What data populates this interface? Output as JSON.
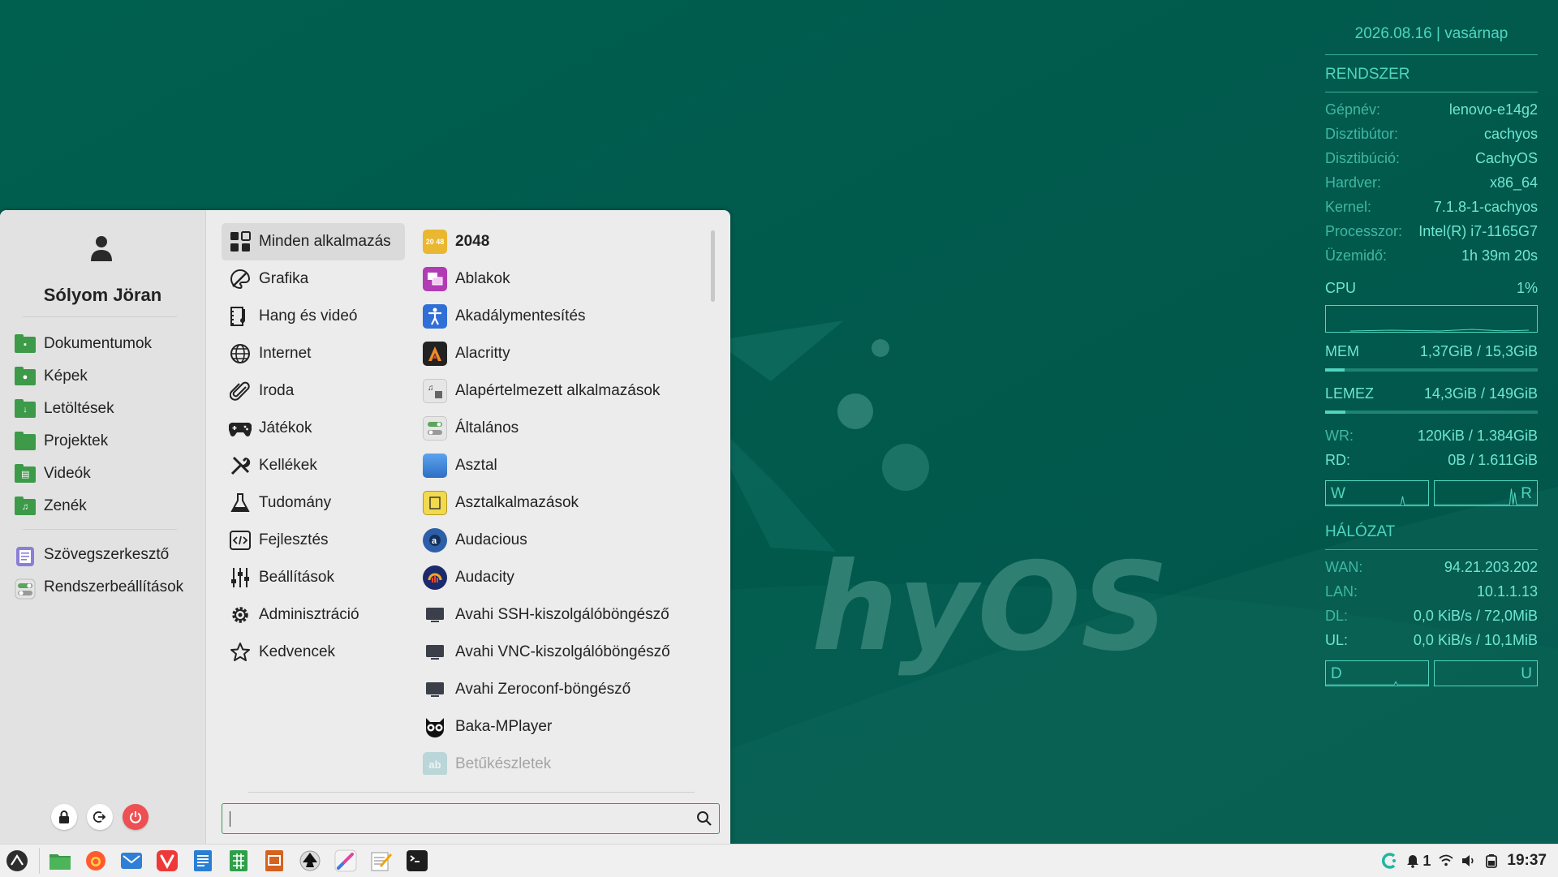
{
  "conky": {
    "date": "2026.08.16 | vasárnap",
    "system_title": "RENDSZER",
    "system": [
      {
        "k": "Gépnév:",
        "v": "lenovo-e14g2"
      },
      {
        "k": "Disztibútor:",
        "v": "cachyos"
      },
      {
        "k": "Disztibúció:",
        "v": "CachyOS"
      },
      {
        "k": "Hardver:",
        "v": "x86_64"
      },
      {
        "k": "Kernel:",
        "v": "7.1.8-1-cachyos"
      },
      {
        "k": "Processzor:",
        "v": "Intel(R) i7-1165G7"
      },
      {
        "k": "Üzemidő:",
        "v": "1h 39m 20s"
      }
    ],
    "cpu_label": "CPU",
    "cpu_value": "1%",
    "mem_label": "MEM",
    "mem_value": "1,37GiB  /  15,3GiB",
    "mem_fraction": 0.09,
    "disk_label": "LEMEZ",
    "disk_value": "14,3GiB  /  149GiB",
    "disk_fraction": 0.096,
    "wr_label": "WR:",
    "wr_value": "120KiB  /  1.384GiB",
    "rd_label": "RD:",
    "rd_value": "0B  /  1.611GiB",
    "w_label": "W",
    "r_label": "R",
    "net_title": "HÁLÓZAT",
    "wan_label": "WAN:",
    "wan_value": "94.21.203.202",
    "lan_label": "LAN:",
    "lan_value": "10.1.1.13",
    "dl_label": "DL:",
    "dl_value": "0,0 KiB/s  /  72,0MiB",
    "ul_label": "UL:",
    "ul_value": "0,0 KiB/s  /  10,1MiB",
    "d_label": "D",
    "u_label": "U"
  },
  "wallpaper": {
    "brand_text": "hyOS"
  },
  "menu": {
    "user_name": "Sólyom Jöran",
    "places": [
      {
        "label": "Dokumentumok",
        "glyph": "▪"
      },
      {
        "label": "Képek",
        "glyph": "●"
      },
      {
        "label": "Letöltések",
        "glyph": "↓"
      },
      {
        "label": "Projektek",
        "glyph": ""
      },
      {
        "label": "Videók",
        "glyph": "▤"
      },
      {
        "label": "Zenék",
        "glyph": "♫"
      }
    ],
    "apps_left": [
      {
        "label": "Szövegszerkesztő"
      },
      {
        "label": "Rendszerbeállítások"
      }
    ],
    "categories": [
      {
        "label": "Minden alkalmazás"
      },
      {
        "label": "Grafika"
      },
      {
        "label": "Hang és videó"
      },
      {
        "label": "Internet"
      },
      {
        "label": "Iroda"
      },
      {
        "label": "Játékok"
      },
      {
        "label": "Kellékek"
      },
      {
        "label": "Tudomány"
      },
      {
        "label": "Fejlesztés"
      },
      {
        "label": "Beállítások"
      },
      {
        "label": "Adminisztráció"
      },
      {
        "label": "Kedvencek"
      }
    ],
    "apps": [
      {
        "label": "2048",
        "icon_text": "20 48",
        "color": "#e9b730"
      },
      {
        "label": "Ablakok",
        "color": "#b13bb5"
      },
      {
        "label": "Akadálymentesítés",
        "color": "#2f6fd6"
      },
      {
        "label": "Alacritty",
        "color": "#222222"
      },
      {
        "label": "Alapértelmezett alkalmazások",
        "color": "#dddddd"
      },
      {
        "label": "Általános",
        "color": "#e4e4e4"
      },
      {
        "label": "Asztal",
        "color": "#3f86e0"
      },
      {
        "label": "Asztalkalmazások",
        "color": "#f2d94e"
      },
      {
        "label": "Audacious",
        "color": "#2d5fa8"
      },
      {
        "label": "Audacity",
        "color": "#1b2a6b"
      },
      {
        "label": "Avahi SSH-kiszolgálóböngésző",
        "color": "#3b3f4a"
      },
      {
        "label": "Avahi VNC-kiszolgálóböngésző",
        "color": "#3b3f4a"
      },
      {
        "label": "Avahi Zeroconf-böngésző",
        "color": "#3b3f4a"
      },
      {
        "label": "Baka-MPlayer",
        "color": "#111111"
      },
      {
        "label": "Betűkészletek",
        "color": "#5fb0b4"
      }
    ],
    "search_placeholder": ""
  },
  "taskbar": {
    "tray_count": "1",
    "clock": "19:37"
  }
}
